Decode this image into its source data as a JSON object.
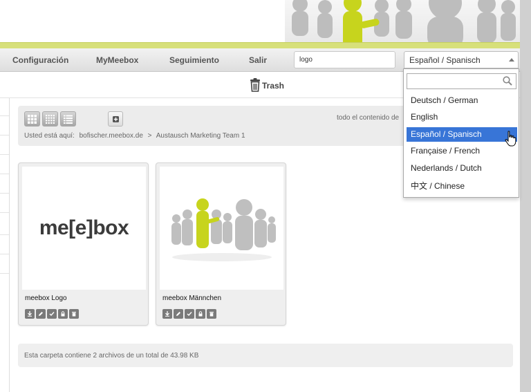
{
  "nav": {
    "items": [
      {
        "label": "Configuración"
      },
      {
        "label": "MyMeebox"
      },
      {
        "label": "Seguimiento"
      },
      {
        "label": "Salir"
      }
    ],
    "search_value": "logo"
  },
  "toolbar": {
    "trash_label": "Trash"
  },
  "content": {
    "folder_info": "todo el contenido de",
    "breadcrumb": {
      "prefix": "Usted está aquí:",
      "path": [
        "bofischer.meebox.de",
        "Austausch Marketing Team 1"
      ],
      "separator": ">"
    }
  },
  "files": [
    {
      "name": "meebox Logo",
      "logo_text": "me[e]box"
    },
    {
      "name": "meebox Männchen"
    }
  ],
  "footer": {
    "text": "Esta carpeta contiene 2 archivos de un total de 43.98 KB"
  },
  "language": {
    "selected": "Español / Spanisch",
    "search_value": "",
    "options": [
      {
        "label": "Deutsch / German"
      },
      {
        "label": "English"
      },
      {
        "label": "Español / Spanisch"
      },
      {
        "label": "Française / French"
      },
      {
        "label": "Nederlands / Dutch"
      },
      {
        "label": "中文 / Chinese"
      }
    ],
    "highlighted_index": 2
  },
  "colors": {
    "accent_green": "#c7d41d",
    "selection_blue": "#3875d7",
    "nav_text": "#555555"
  }
}
